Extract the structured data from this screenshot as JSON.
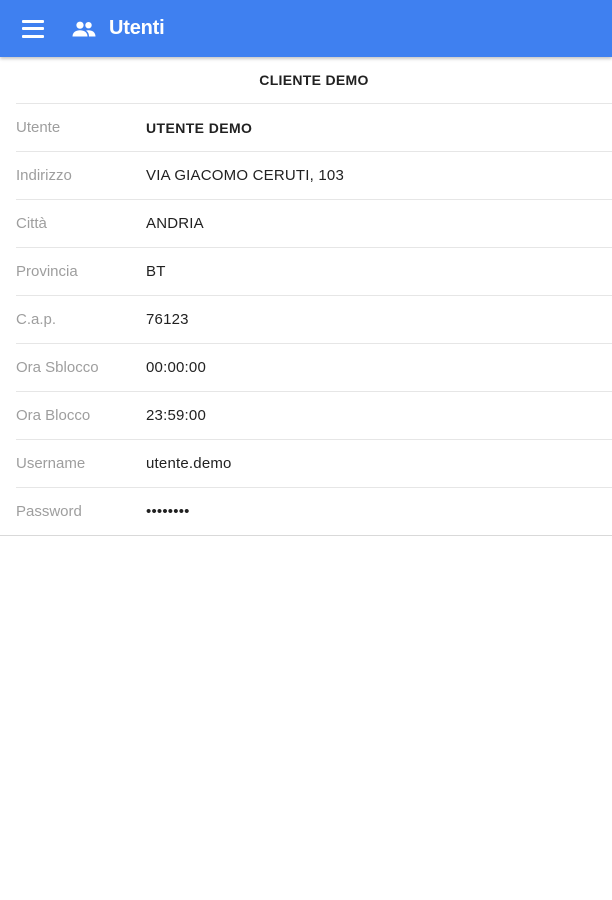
{
  "colors": {
    "appbar": "#3f80f0",
    "label": "#9e9e9e",
    "value": "#212121",
    "divider": "#e6e6e6"
  },
  "appbar": {
    "menu_icon": "hamburger-menu-icon",
    "section_icon": "people-icon",
    "title": "Utenti"
  },
  "client": {
    "name": "CLIENTE DEMO"
  },
  "details": [
    {
      "label": "Utente",
      "value": "UTENTE DEMO"
    },
    {
      "label": "Indirizzo",
      "value": "VIA GIACOMO CERUTI, 103"
    },
    {
      "label": "Città",
      "value": "ANDRIA"
    },
    {
      "label": "Provincia",
      "value": "BT"
    },
    {
      "label": "C.a.p.",
      "value": "76123"
    },
    {
      "label": "Ora Sblocco",
      "value": "00:00:00"
    },
    {
      "label": "Ora Blocco",
      "value": "23:59:00"
    },
    {
      "label": "Username",
      "value": "utente.demo"
    },
    {
      "label": "Password",
      "value": "••••••••"
    }
  ]
}
